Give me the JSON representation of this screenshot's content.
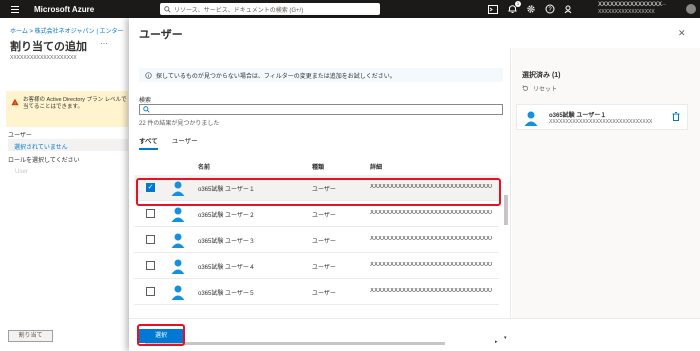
{
  "topbar": {
    "brand": "Microsoft Azure",
    "search_placeholder": "リソース、サービス、ドキュメントの検索 (G+/)",
    "notification_count": "1",
    "account_name": "XXXXXXXXXXXXXXXX··",
    "account_sub": "XXXXXXXXXXXXXXXXX"
  },
  "background_page": {
    "breadcrumb": "ホーム > 株式会社ネオジャパン | エンター",
    "title": "割り当ての追加",
    "more": "···",
    "subtitle": "XXXXXXXXXXXXXXXXXXXX",
    "warning_text": "お客様の Active Directory プラン レベルで当てることはできます。",
    "users_label": "ユーザー",
    "not_selected": "選択されていません",
    "role_label": "ロールを選択してください",
    "user_link": "User",
    "assign_button": "割り当て"
  },
  "panel": {
    "title": "ユーザー",
    "close": "✕",
    "info_text": "探しているものが見つからない場合は、フィルターの変更または追加をお試しください。",
    "search_label": "検索",
    "search_value": "",
    "result_count": "22 件の結果が見つかりました",
    "tabs": [
      "すべて",
      "ユーザー"
    ],
    "active_tab": 0,
    "columns": {
      "name": "名前",
      "type": "種類",
      "detail": "詳細"
    },
    "rows": [
      {
        "name": "o365試験 ユーザー１",
        "type": "ユーザー",
        "detail": "XXXXXXXXXXXXXXXXXXXXXXXXXXXXXXX",
        "checked": true
      },
      {
        "name": "o365試験 ユーザー２",
        "type": "ユーザー",
        "detail": "XXXXXXXXXXXXXXXXXXXXXXXXXXXXXXX",
        "checked": false
      },
      {
        "name": "o365試験 ユーザー３",
        "type": "ユーザー",
        "detail": "XXXXXXXXXXXXXXXXXXXXXXXXXXXXXXX",
        "checked": false
      },
      {
        "name": "o365試験 ユーザー４",
        "type": "ユーザー",
        "detail": "XXXXXXXXXXXXXXXXXXXXXXXXXXXXXXX",
        "checked": false
      },
      {
        "name": "o365試験 ユーザー５",
        "type": "ユーザー",
        "detail": "XXXXXXXXXXXXXXXXXXXXXXXXXXXXXXX",
        "checked": false
      }
    ],
    "select_button": "選択"
  },
  "selected_pane": {
    "title": "選択済み (1)",
    "reset": "リセット",
    "item_name": "o365試験 ユーザー１",
    "item_detail": "XXXXXXXXXXXXXXXXXXXXXXXXXXXXXXX"
  },
  "colors": {
    "accent": "#0078d4",
    "highlight": "#e81123",
    "topbar": "#1b1a19"
  }
}
